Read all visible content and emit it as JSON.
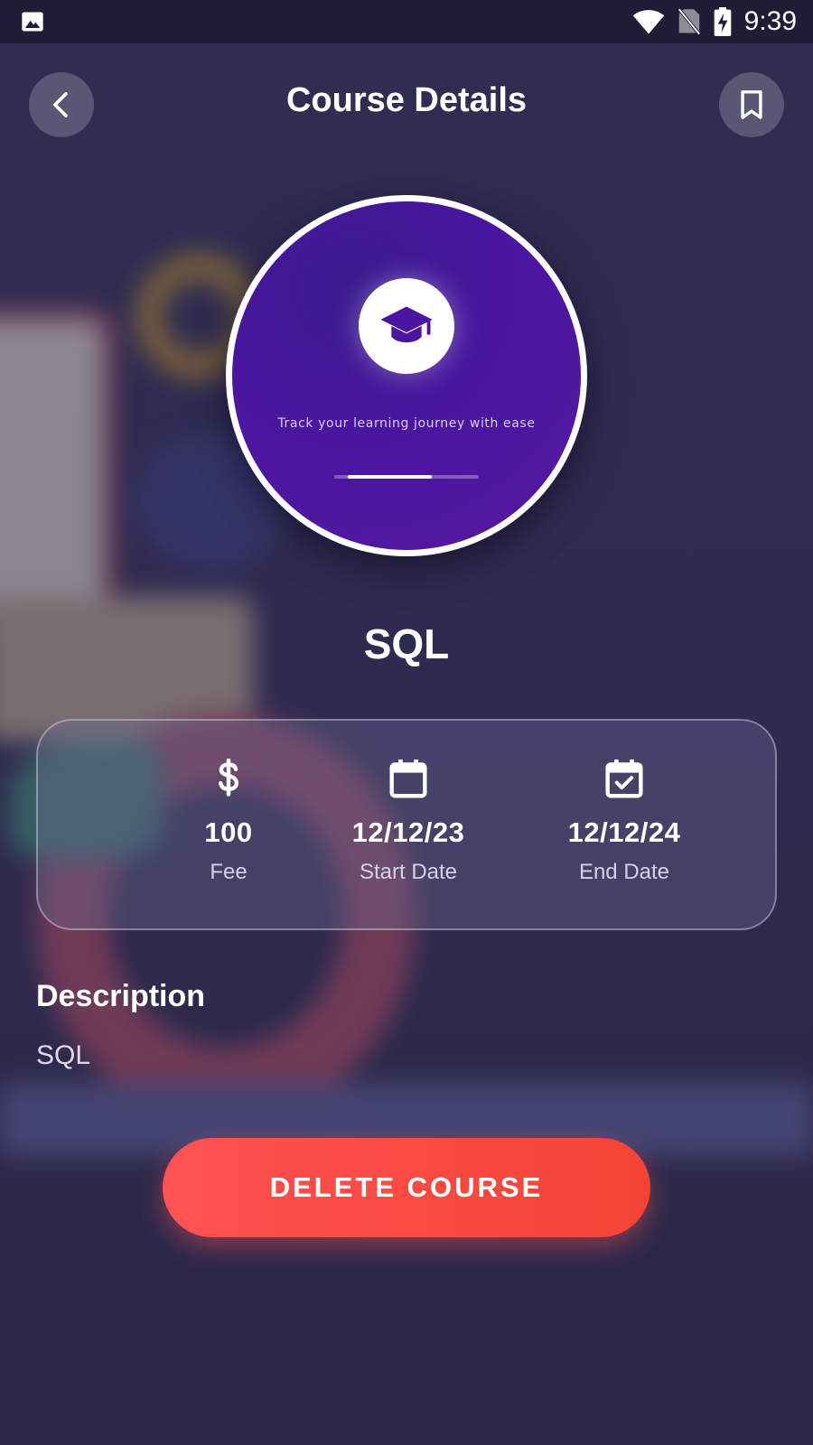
{
  "status_bar": {
    "time": "9:39",
    "icons": [
      "gallery-icon",
      "wifi-icon",
      "no-sim-icon",
      "battery-charging-icon"
    ]
  },
  "header": {
    "title": "Course Details",
    "back_icon": "chevron-left-icon",
    "bookmark_icon": "bookmark-icon"
  },
  "hero": {
    "icon": "graduation-cap-icon",
    "tagline": "Track your learning journey with ease",
    "progress": 0.64
  },
  "course": {
    "name": "SQL"
  },
  "info": [
    {
      "icon": "dollar-icon",
      "value": "100",
      "label": "Fee"
    },
    {
      "icon": "calendar-icon",
      "value": "12/12/23",
      "label": "Start Date"
    },
    {
      "icon": "calendar-check-icon",
      "value": "12/12/24",
      "label": "End Date"
    }
  ],
  "description": {
    "heading": "Description",
    "text": "SQL"
  },
  "actions": {
    "delete_label": "DELETE COURSE"
  },
  "colors": {
    "background": "#2e2b50",
    "hero_purple": "#4a16a0",
    "danger": "#f44336"
  }
}
